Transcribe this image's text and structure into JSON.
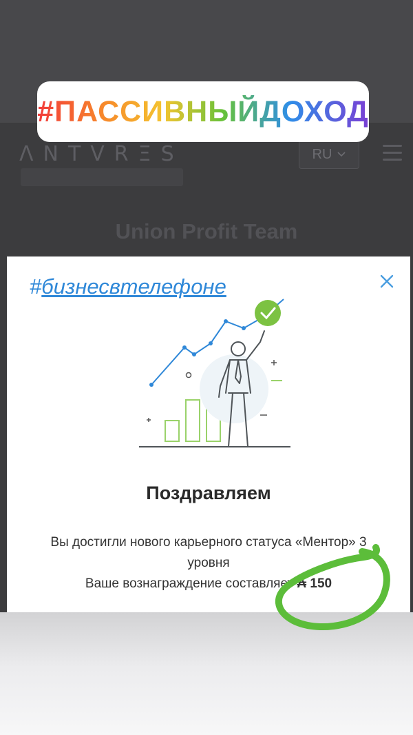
{
  "story": {
    "hashtag_top": "#ПАССИВНЫЙДОХОД"
  },
  "header": {
    "logo": "ΛNTVRΞS",
    "language": "RU",
    "page_title": "Union Profit Team"
  },
  "modal": {
    "hashtag_symbol": "#",
    "hashtag_text": "бизнесвтелефоне",
    "title": "Поздравляем",
    "message_line1": "Вы достигли нового карьерного статуса «Ментор» 3",
    "message_line2": "уровня",
    "reward_label": "Ваше вознаграждение составляет",
    "reward_currency": "₳",
    "reward_value": "150"
  },
  "colors": {
    "accent_blue": "#2f88d8",
    "check_green": "#7cc242",
    "marker_green": "#5cbd3a"
  },
  "icons": {
    "close": "close-icon",
    "menu": "hamburger-menu-icon",
    "chevron": "chevron-down-icon"
  }
}
